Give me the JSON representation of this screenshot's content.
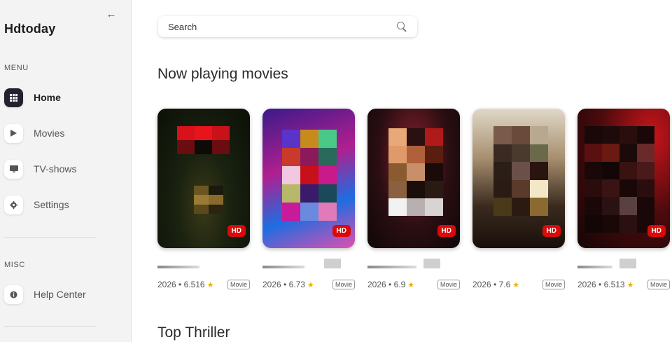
{
  "app": {
    "brand": "Hdtoday"
  },
  "sidebar": {
    "back_icon": "arrow-left-icon",
    "menu_label": "MENU",
    "items": [
      {
        "label": "Home",
        "icon": "grid-icon",
        "active": true
      },
      {
        "label": "Movies",
        "icon": "play-icon",
        "active": false
      },
      {
        "label": "TV-shows",
        "icon": "tv-icon",
        "active": false
      },
      {
        "label": "Settings",
        "icon": "gear-icon",
        "active": false
      }
    ],
    "misc_label": "MISC",
    "misc_items": [
      {
        "label": "Help Center",
        "icon": "info-icon"
      }
    ]
  },
  "search": {
    "placeholder": "Search"
  },
  "sections": {
    "now_playing": "Now playing movies",
    "top_thriller": "Top Thriller"
  },
  "movies": [
    {
      "year": "2026",
      "rating": "6.516",
      "type": "Movie",
      "quality": "HD"
    },
    {
      "year": "2026",
      "rating": "6.73",
      "type": "Movie",
      "quality": "HD"
    },
    {
      "year": "2026",
      "rating": "6.9",
      "type": "Movie",
      "quality": "HD"
    },
    {
      "year": "2026",
      "rating": "7.6",
      "type": "Movie",
      "quality": "HD"
    },
    {
      "year": "2026",
      "rating": "6.513",
      "type": "Movie",
      "quality": "HD"
    }
  ],
  "colors": {
    "accent": "#22212f",
    "hd_badge": "#d90a0a",
    "star": "#e5b300"
  }
}
